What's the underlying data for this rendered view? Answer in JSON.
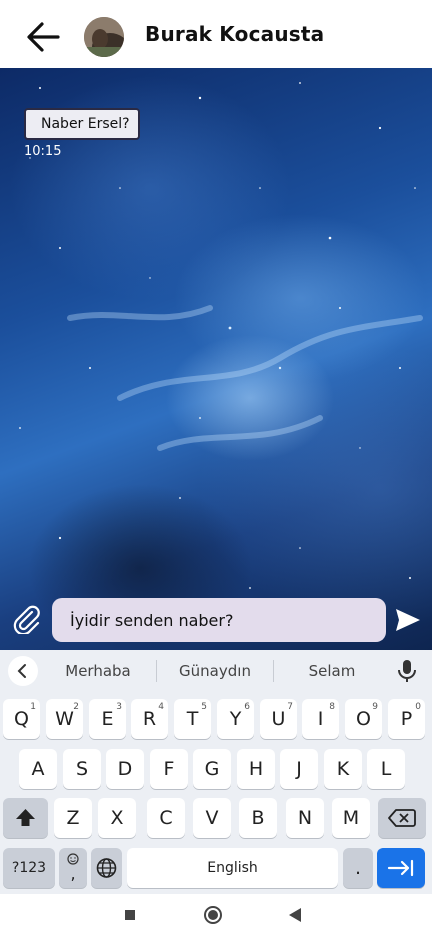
{
  "header": {
    "contact_name": "Burak Kocausta",
    "back_icon": "arrow-left-icon"
  },
  "chat": {
    "messages": [
      {
        "text": "Naber Ersel?",
        "time": "10:15"
      }
    ]
  },
  "composer": {
    "input_value": "İyidir senden naber?",
    "attach_icon": "paperclip-icon",
    "send_icon": "send-icon"
  },
  "keyboard": {
    "suggestions": [
      "Merhaba",
      "Günaydın",
      "Selam"
    ],
    "row1": [
      {
        "k": "Q",
        "n": "1"
      },
      {
        "k": "W",
        "n": "2"
      },
      {
        "k": "E",
        "n": "3"
      },
      {
        "k": "R",
        "n": "4"
      },
      {
        "k": "T",
        "n": "5"
      },
      {
        "k": "Y",
        "n": "6"
      },
      {
        "k": "U",
        "n": "7"
      },
      {
        "k": "I",
        "n": "8"
      },
      {
        "k": "O",
        "n": "9"
      },
      {
        "k": "P",
        "n": "0"
      }
    ],
    "row2": [
      "A",
      "S",
      "D",
      "F",
      "G",
      "H",
      "J",
      "K",
      "L"
    ],
    "row3": [
      "Z",
      "X",
      "C",
      "V",
      "B",
      "N",
      "M"
    ],
    "sym_label": "?123",
    "emoji_sub": ",",
    "space_label": "English",
    "period_label": "."
  }
}
